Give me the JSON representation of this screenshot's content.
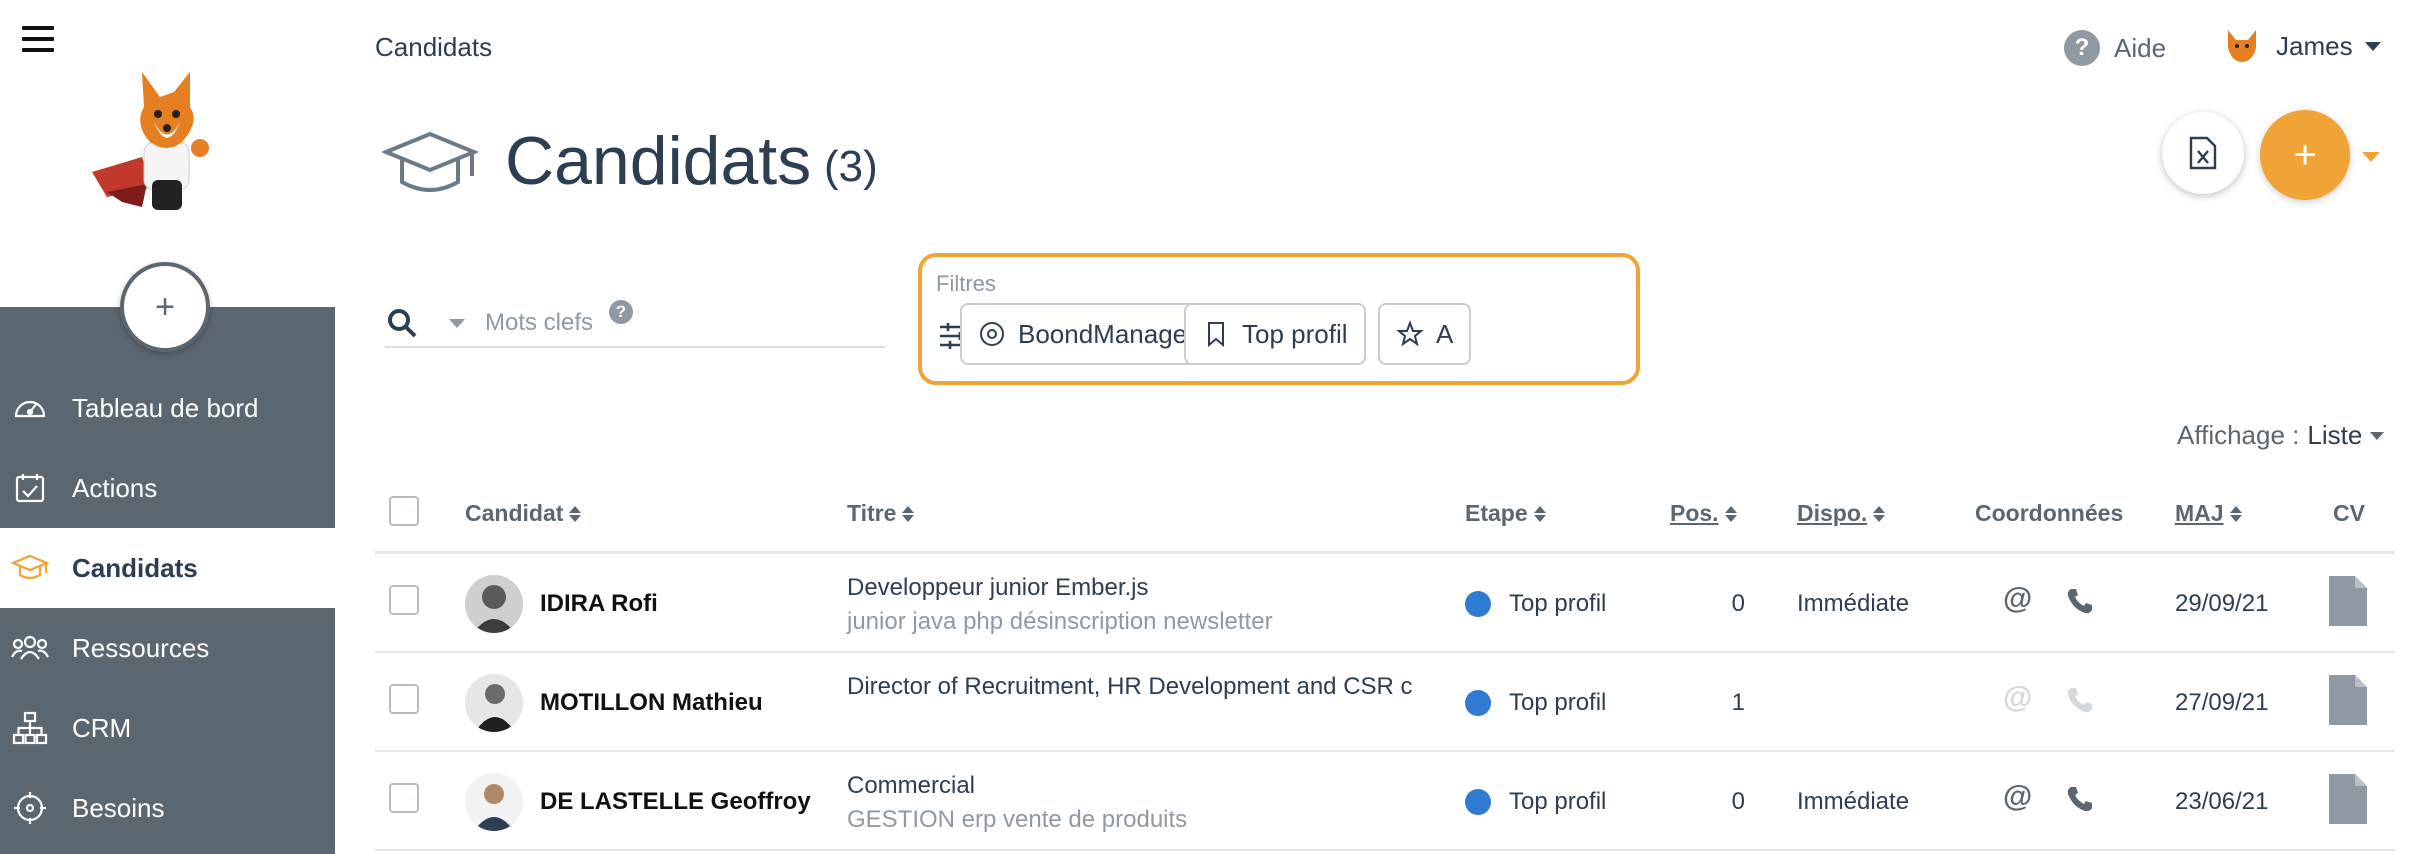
{
  "sidebar": {
    "add_label": "+",
    "items": [
      {
        "label": "Tableau de bord",
        "icon": "dashboard-gauge-icon"
      },
      {
        "label": "Actions",
        "icon": "calendar-check-icon"
      },
      {
        "label": "Candidats",
        "icon": "graduation-cap-icon",
        "active": true
      },
      {
        "label": "Ressources",
        "icon": "people-group-icon"
      },
      {
        "label": "CRM",
        "icon": "org-chart-icon"
      },
      {
        "label": "Besoins",
        "icon": "crosshair-target-icon"
      }
    ]
  },
  "header": {
    "breadcrumb": "Candidats",
    "help_label": "Aide",
    "help_glyph": "?",
    "user_name": "James"
  },
  "page": {
    "title": "Candidats",
    "count": "(3)",
    "add_label": "+"
  },
  "search": {
    "placeholder": "Mots clefs",
    "help_glyph": "?"
  },
  "filters": {
    "label": "Filtres",
    "chips": [
      {
        "label": "BoondManager France",
        "icon": "target-circle-icon"
      },
      {
        "label": "Top profil",
        "icon": "bookmark-icon"
      },
      {
        "label": "A",
        "icon": "star-icon"
      }
    ]
  },
  "display": {
    "label": "Affichage :",
    "value": "Liste"
  },
  "table": {
    "columns": {
      "candidate": "Candidat",
      "title": "Titre",
      "step": "Etape",
      "pos": "Pos.",
      "dispo": "Dispo.",
      "contact": "Coordonnées",
      "updated": "MAJ",
      "cv": "CV"
    },
    "rows": [
      {
        "name": "IDIRA Rofi",
        "title": "Developpeur junior Ember.js",
        "tags": "junior java php désinscription newsletter",
        "step": "Top profil",
        "pos": "0",
        "dispo": "Immédiate",
        "at": "@",
        "contact_active": true,
        "updated": "29/09/21"
      },
      {
        "name": "MOTILLON Mathieu",
        "title": "Director of Recruitment, HR Development and CSR c",
        "tags": "",
        "step": "Top profil",
        "pos": "1",
        "dispo": "",
        "at": "@",
        "contact_active": false,
        "updated": "27/09/21"
      },
      {
        "name": "DE LASTELLE Geoffroy",
        "title": "Commercial",
        "tags": "GESTION erp vente de produits",
        "step": "Top profil",
        "pos": "0",
        "dispo": "Immédiate",
        "at": "@",
        "contact_active": true,
        "updated": "23/06/21"
      }
    ]
  },
  "colors": {
    "sidebar_bg": "#5b6770",
    "accent_orange": "#f0a336",
    "step_blue": "#2f7bd1",
    "text_dark": "#2c3e50",
    "text_muted": "#8e99a4"
  }
}
